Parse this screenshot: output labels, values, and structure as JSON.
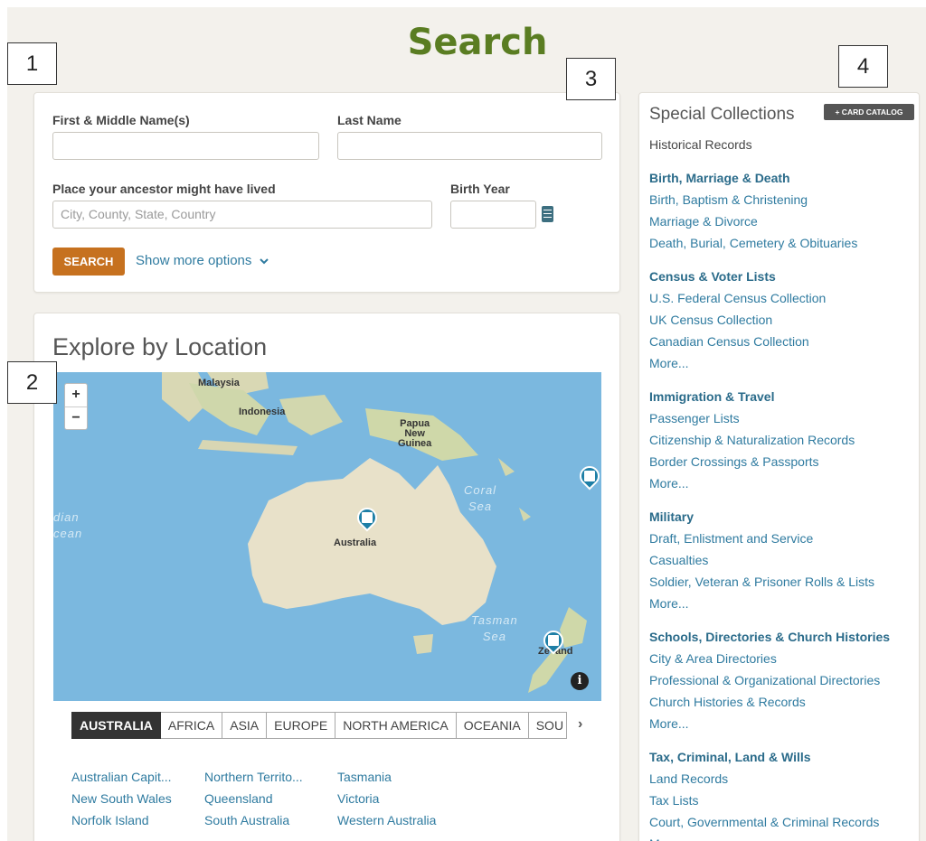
{
  "page": {
    "title": "Search"
  },
  "callouts": [
    "1",
    "2",
    "3",
    "4"
  ],
  "search": {
    "first_name_label": "First & Middle Name(s)",
    "first_name_value": "",
    "last_name_label": "Last Name",
    "last_name_value": "",
    "place_label": "Place your ancestor might have lived",
    "place_placeholder": "City, County, State, Country",
    "birth_year_label": "Birth Year",
    "birth_year_value": "",
    "search_button": "SEARCH",
    "more_options": "Show more options",
    "calendar_icon": "calendar-icon",
    "chevron_icon": "chevron-down-icon"
  },
  "explore": {
    "title": "Explore by Location",
    "map": {
      "zoom_in": "+",
      "zoom_out": "−",
      "labels": {
        "malaysia": "Malaysia",
        "indonesia": "Indonesia",
        "papua": "Papua\nNew\nGuinea",
        "australia": "Australia",
        "indian_ocean": "dian\ncean",
        "coral_sea": "Coral\nSea",
        "tasman_sea": "Tasman\nSea",
        "nz": "Ze  and"
      },
      "info": "i",
      "colors": {
        "water": "#7bb8df",
        "land": "#e8e1c9",
        "pin": "#1e7fa6"
      }
    },
    "tabs": [
      "AUSTRALIA",
      "AFRICA",
      "ASIA",
      "EUROPE",
      "NORTH AMERICA",
      "OCEANIA",
      "SOU"
    ],
    "tabs_arrow": "›",
    "regions": [
      "Australian Capit...",
      "Northern Territo...",
      "Tasmania",
      "New South Wales",
      "Queensland",
      "Victoria",
      "Norfolk Island",
      "South Australia",
      "Western Australia"
    ]
  },
  "sidebar": {
    "title": "Special Collections",
    "card_catalog": "+ CARD CATALOG",
    "subtitle": "Historical Records",
    "groups": [
      {
        "heading": "Birth, Marriage & Death",
        "links": [
          "Birth, Baptism & Christening",
          "Marriage & Divorce",
          "Death, Burial, Cemetery & Obituaries"
        ]
      },
      {
        "heading": "Census & Voter Lists",
        "links": [
          "U.S. Federal Census Collection",
          "UK Census Collection",
          "Canadian Census Collection",
          "More..."
        ]
      },
      {
        "heading": "Immigration & Travel",
        "links": [
          "Passenger Lists",
          "Citizenship & Naturalization Records",
          "Border Crossings & Passports",
          "More..."
        ]
      },
      {
        "heading": "Military",
        "links": [
          "Draft, Enlistment and Service",
          "Casualties",
          "Soldier, Veteran & Prisoner Rolls & Lists",
          "More..."
        ]
      },
      {
        "heading": "Schools, Directories & Church Histories",
        "links": [
          "City & Area Directories",
          "Professional & Organizational Directories",
          "Church Histories & Records",
          "More..."
        ]
      },
      {
        "heading": "Tax, Criminal, Land & Wills",
        "links": [
          "Land Records",
          "Tax Lists",
          "Court, Governmental & Criminal Records",
          "More..."
        ]
      }
    ]
  }
}
